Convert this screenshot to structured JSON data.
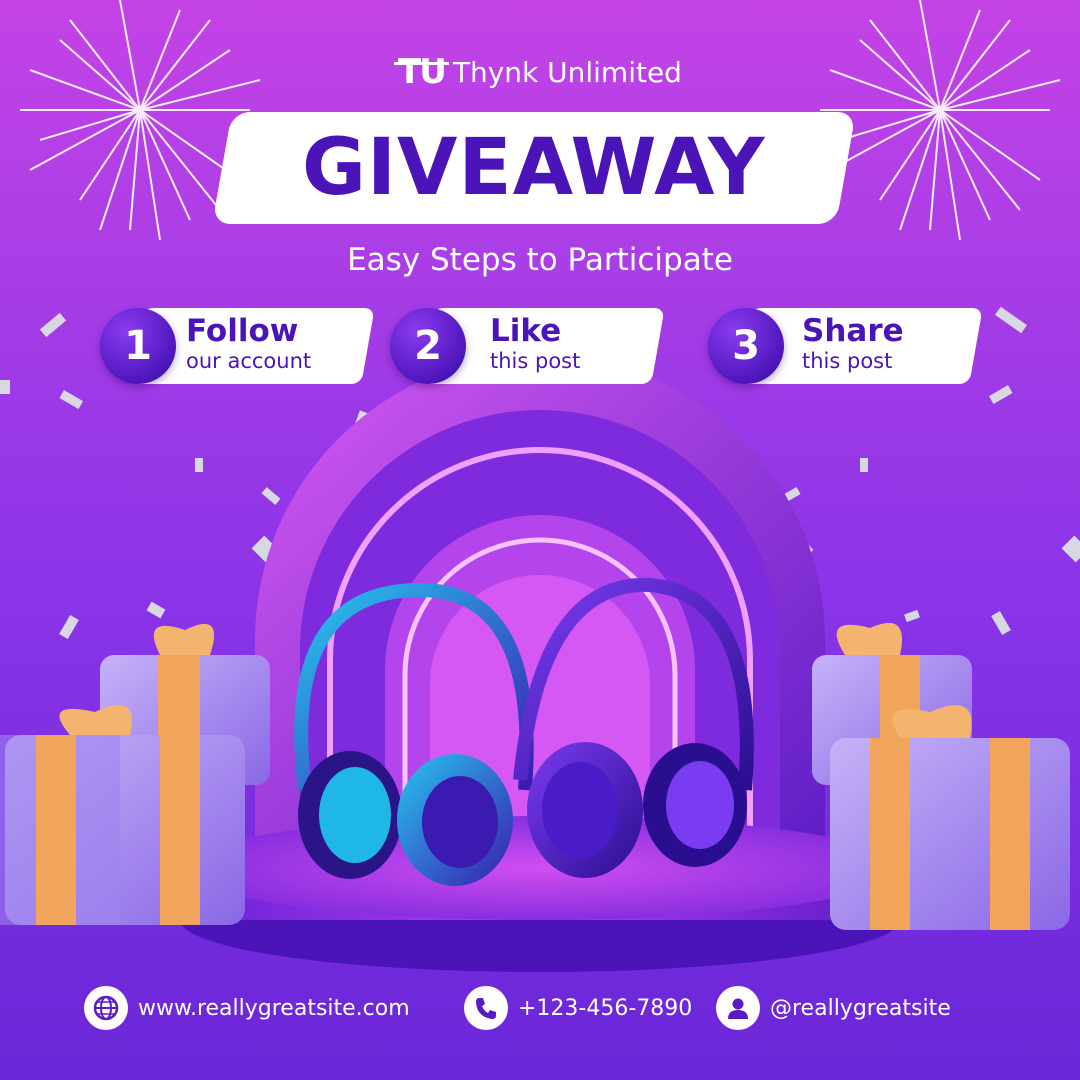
{
  "brand": {
    "logo_mark": "TU",
    "name": "Thynk Unlimited"
  },
  "title": "GIVEAWAY",
  "subtitle": "Easy Steps to Participate",
  "steps": [
    {
      "number": "1",
      "title": "Follow",
      "subtitle": "our account"
    },
    {
      "number": "2",
      "title": "Like",
      "subtitle": "this post"
    },
    {
      "number": "3",
      "title": "Share",
      "subtitle": "this post"
    }
  ],
  "contacts": [
    {
      "icon": "globe-icon",
      "text": "www.reallygreatsite.com"
    },
    {
      "icon": "phone-icon",
      "text": "+123-456-7890"
    },
    {
      "icon": "user-icon",
      "text": "@reallygreatsite"
    }
  ],
  "colors": {
    "accent": "#4a14b8",
    "background_top": "#c443e6",
    "background_bottom": "#6a26d8",
    "gift_box": "#a48ef0",
    "ribbon": "#f0a45c"
  }
}
